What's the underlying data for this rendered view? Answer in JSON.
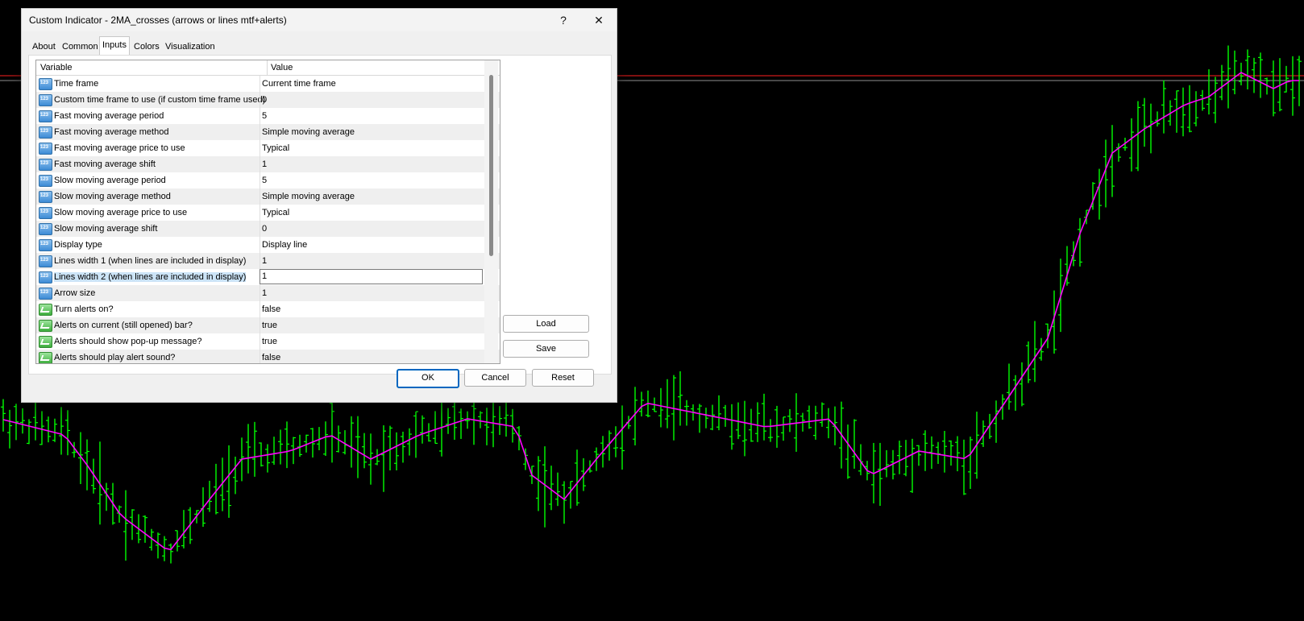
{
  "window": {
    "title": "Custom Indicator - 2MA_crosses (arrows or lines mtf+alerts)",
    "help_glyph": "?",
    "close_glyph": "✕"
  },
  "tabs": [
    {
      "label": "About"
    },
    {
      "label": "Common"
    },
    {
      "label": "Inputs"
    },
    {
      "label": "Colors"
    },
    {
      "label": "Visualization"
    }
  ],
  "grid": {
    "col_variable": "Variable",
    "col_value": "Value",
    "rows": [
      {
        "variable": "Time frame",
        "value": "Current time frame",
        "icon": "number-icon"
      },
      {
        "variable": "Custom time frame to use (if custom time frame used)",
        "value": "0",
        "icon": "number-icon"
      },
      {
        "variable": "Fast moving average period",
        "value": "5",
        "icon": "number-icon"
      },
      {
        "variable": "Fast moving average method",
        "value": "Simple moving average",
        "icon": "number-icon"
      },
      {
        "variable": "Fast moving average price to use",
        "value": "Typical",
        "icon": "number-icon"
      },
      {
        "variable": "Fast moving average shift",
        "value": "1",
        "icon": "number-icon"
      },
      {
        "variable": "Slow moving average period",
        "value": "5",
        "icon": "number-icon"
      },
      {
        "variable": "Slow moving average method",
        "value": "Simple moving average",
        "icon": "number-icon"
      },
      {
        "variable": "Slow moving average price to use",
        "value": "Typical",
        "icon": "number-icon"
      },
      {
        "variable": "Slow moving average shift",
        "value": "0",
        "icon": "number-icon"
      },
      {
        "variable": "Display type",
        "value": "Display line",
        "icon": "number-icon"
      },
      {
        "variable": "Lines width 1 (when lines are included in display)",
        "value": "1",
        "icon": "number-icon"
      },
      {
        "variable": "Lines width 2 (when lines are included in display)",
        "value": "1",
        "icon": "number-icon"
      },
      {
        "variable": "Arrow size",
        "value": "1",
        "icon": "number-icon"
      },
      {
        "variable": "Turn alerts on?",
        "value": "false",
        "icon": "boolean-icon"
      },
      {
        "variable": "Alerts on current (still opened) bar?",
        "value": "true",
        "icon": "boolean-icon"
      },
      {
        "variable": "Alerts should show pop-up message?",
        "value": "true",
        "icon": "boolean-icon"
      },
      {
        "variable": "Alerts should play alert sound?",
        "value": "false",
        "icon": "boolean-icon"
      }
    ]
  },
  "buttons": {
    "load": "Load",
    "save": "Save",
    "ok": "OK",
    "cancel": "Cancel",
    "reset": "Reset"
  },
  "chart": {
    "background": "#000000",
    "bar_color": "#00ff00",
    "ma_color": "#ff00ff",
    "hline_colors": [
      "#ff2020",
      "#909090"
    ]
  }
}
